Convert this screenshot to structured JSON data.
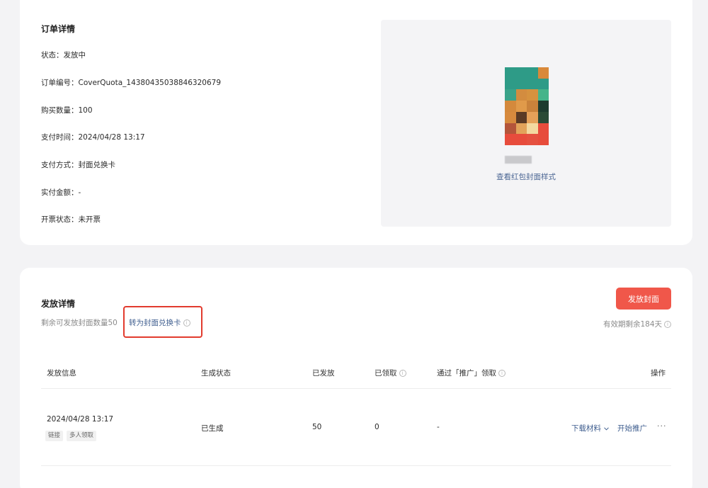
{
  "order": {
    "title": "订单详情",
    "fields": [
      {
        "label": "状态：",
        "value": "发放中"
      },
      {
        "label": "订单编号：",
        "value": "CoverQuota_14380435038846320679"
      },
      {
        "label": "购买数量：",
        "value": "100"
      },
      {
        "label": "支付时间：",
        "value": "2024/04/28 13:17"
      },
      {
        "label": "支付方式：",
        "value": "封面兑换卡"
      },
      {
        "label": "实付金额：",
        "value": "-"
      },
      {
        "label": "开票状态：",
        "value": "未开票"
      }
    ],
    "preview": {
      "link_label": "查看红包封面样式"
    }
  },
  "distribution": {
    "title": "发放详情",
    "remaining_text": "剩余可发放封面数量50",
    "convert_label": "转为封面兑换卡",
    "distribute_button": "发放封面",
    "validity_text": "有效期剩余184天",
    "info_glyph": "i",
    "table": {
      "headers": [
        "发放信息",
        "生成状态",
        "已发放",
        "已领取",
        "通过「推广」领取",
        "操作"
      ],
      "rows": [
        {
          "time": "2024/04/28 13:17",
          "tags": [
            "链接",
            "多人领取"
          ],
          "status": "已生成",
          "issued": "50",
          "claimed": "0",
          "via_promo": "-",
          "actions": {
            "download": "下载材料",
            "promote": "开始推广",
            "more": "···"
          }
        }
      ]
    }
  },
  "colors": {
    "primary_button": "#f0574a",
    "link": "#3f5e8f",
    "highlight_box": "#e23b2e"
  }
}
